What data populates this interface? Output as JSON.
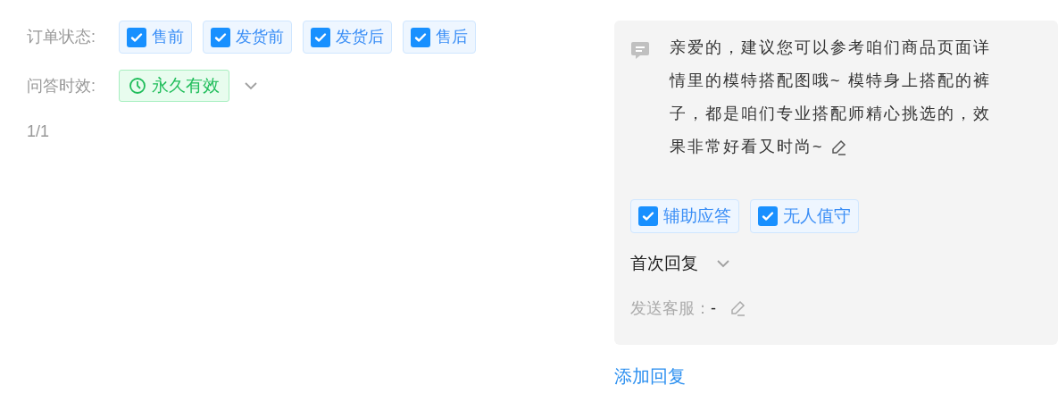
{
  "order_status": {
    "label": "订单状态:",
    "options": [
      {
        "label": "售前",
        "checked": true
      },
      {
        "label": "发货前",
        "checked": true
      },
      {
        "label": "发货后",
        "checked": true
      },
      {
        "label": "售后",
        "checked": true
      }
    ]
  },
  "validity": {
    "label": "问答时效:",
    "tag": "永久有效"
  },
  "page": "1/1",
  "reply": {
    "message": "亲爱的，建议您可以参考咱们商品页面详情里的模特搭配图哦~ 模特身上搭配的裤子，都是咱们专业搭配师精心挑选的，效果非常好看又时尚~",
    "options": [
      {
        "label": "辅助应答",
        "checked": true
      },
      {
        "label": "无人值守",
        "checked": true
      }
    ],
    "reply_type": "首次回复",
    "agent": {
      "label": "发送客服：",
      "value": "-"
    }
  },
  "add_reply": "添加回复"
}
